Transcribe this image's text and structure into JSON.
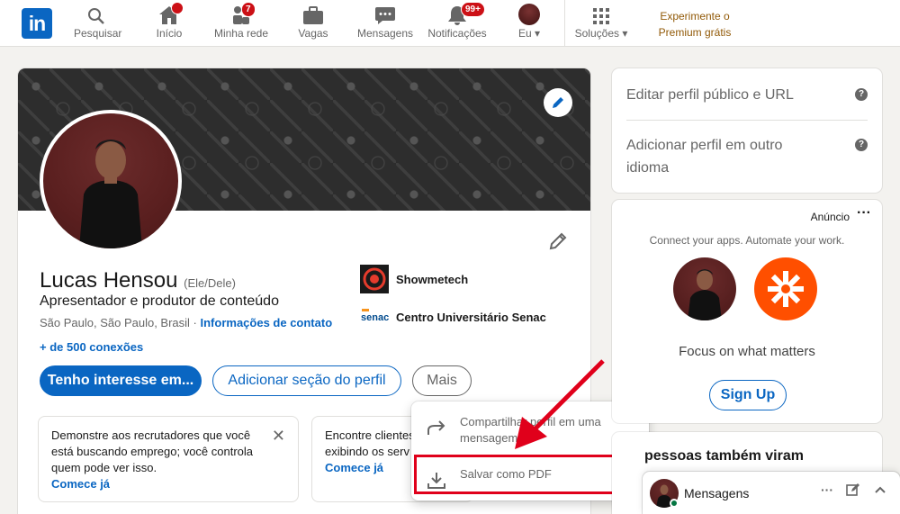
{
  "nav": {
    "items": [
      {
        "label": "Pesquisar",
        "icon": "search-icon"
      },
      {
        "label": "Início",
        "icon": "home-icon",
        "badge": ""
      },
      {
        "label": "Minha rede",
        "icon": "network-icon",
        "badge": "7"
      },
      {
        "label": "Vagas",
        "icon": "briefcase-icon"
      },
      {
        "label": "Mensagens",
        "icon": "messaging-icon"
      },
      {
        "label": "Notificações",
        "icon": "bell-icon",
        "badge": "99+"
      },
      {
        "label": "Eu",
        "icon": "avatar"
      },
      {
        "label": "Soluções",
        "icon": "grid-icon"
      }
    ],
    "premium_line1": "Experimente o",
    "premium_line2": "Premium grátis"
  },
  "profile": {
    "name": "Lucas Hensou",
    "pronoun": "(Ele/Dele)",
    "headline": "Apresentador e produtor de conteúdo",
    "location": "São Paulo, São Paulo, Brasil · ",
    "contact_link": "Informações de contato",
    "connections": "+ de 500 conexões",
    "experience": [
      {
        "name": "Showmetech"
      },
      {
        "name": "Centro Universitário Senac"
      }
    ],
    "buttons": {
      "primary": "Tenho interesse em...",
      "outline": "Adicionar seção do perfil",
      "more": "Mais"
    },
    "tips": [
      {
        "text": "Demonstre aos recrutadores que você está buscando emprego; você controla quem pode ver isso.",
        "link": "Comece já"
      },
      {
        "text": "Encontre clientes exibindo os serv",
        "link": "Comece já"
      }
    ]
  },
  "dropdown": {
    "share": "Compartilhar perfil em uma mensagem",
    "save_pdf": "Salvar como PDF"
  },
  "right": {
    "edit_public": "Editar perfil público e URL",
    "add_language": "Adicionar perfil em outro idioma",
    "ad_label": "Anúncio",
    "ad_sub": "Connect your apps. Automate your work.",
    "ad_tagline": "Focus on what matters",
    "ad_button": "Sign Up",
    "also_viewed": "pessoas também viram"
  },
  "messaging": {
    "title": "Mensagens"
  },
  "colors": {
    "brand": "#0a66c2",
    "highlight": "#e0001b",
    "badge": "#cc1016",
    "ad_brand": "#ff4f00"
  }
}
